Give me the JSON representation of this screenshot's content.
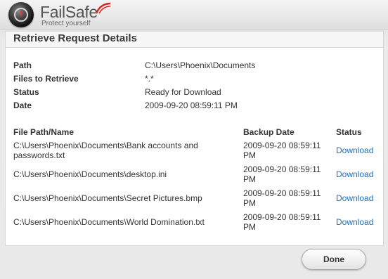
{
  "brand": {
    "name": "FailSafe",
    "tagline": "Protect yourself",
    "accent_color": "#d22"
  },
  "dialog": {
    "title": "Retrieve Request Details"
  },
  "details": [
    {
      "label": "Path",
      "value": "C:\\Users\\Phoenix\\Documents"
    },
    {
      "label": "Files to Retrieve",
      "value": "*.*"
    },
    {
      "label": "Status",
      "value": "Ready for Download"
    },
    {
      "label": "Date",
      "value": "2009-09-20 08:59:11 PM"
    }
  ],
  "files_table": {
    "headers": {
      "name": "File Path/Name",
      "date": "Backup Date",
      "status": "Status"
    },
    "rows": [
      {
        "name": "C:\\Users\\Phoenix\\Documents\\Bank accounts and passwords.txt",
        "date": "2009-09-20 08:59:11 PM",
        "action": "Download"
      },
      {
        "name": "C:\\Users\\Phoenix\\Documents\\desktop.ini",
        "date": "2009-09-20 08:59:11 PM",
        "action": "Download"
      },
      {
        "name": "C:\\Users\\Phoenix\\Documents\\Secret Pictures.bmp",
        "date": "2009-09-20 08:59:11 PM",
        "action": "Download"
      },
      {
        "name": "C:\\Users\\Phoenix\\Documents\\World Domination.txt",
        "date": "2009-09-20 08:59:11 PM",
        "action": "Download"
      }
    ]
  },
  "footer": {
    "done_label": "Done"
  }
}
